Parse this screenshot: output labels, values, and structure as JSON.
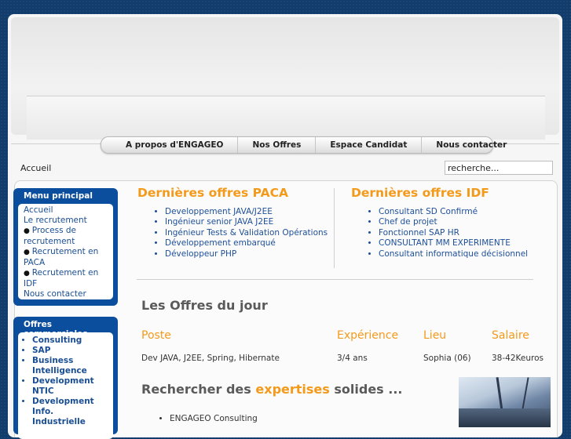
{
  "nav": {
    "items": [
      {
        "label": "A propos d'ENGAGEO"
      },
      {
        "label": "Nos Offres"
      },
      {
        "label": "Espace Candidat"
      },
      {
        "label": "Nous contacter"
      }
    ]
  },
  "breadcrumb": "Accueil",
  "search": {
    "value": "recherche..."
  },
  "sidebar": {
    "main_menu": {
      "title": "Menu principal",
      "items": [
        "Accueil",
        "Le recrutement",
        "Process de recrutement",
        "Recrutement en PACA",
        "Recrutement en IDF",
        "Nous contacter"
      ]
    },
    "commercial": {
      "title": "Offres commerciales",
      "items": [
        "Consulting",
        "SAP",
        "Business Intelligence",
        "Development NTIC",
        "Development Info. Industrielle"
      ]
    }
  },
  "paca": {
    "title": "Dernières offres PACA",
    "items": [
      "Developpement JAVA/J2EE",
      "Ingénieur senior JAVA J2EE",
      "Ingénieur Tests & Validation Opérations",
      "Développement embarqué",
      "Développeur PHP"
    ]
  },
  "idf": {
    "title": "Dernières offres IDF",
    "items": [
      "Consultant SD Confirmé",
      "Chef de projet",
      "Fonctionnel SAP HR",
      "CONSULTANT MM EXPERIMENTE",
      "Consultant informatique décisionnel"
    ]
  },
  "offres_du_jour": {
    "title": "Les Offres du jour",
    "headers": [
      "Poste",
      "Expérience",
      "Lieu",
      "Salaire"
    ],
    "row": [
      "Dev JAVA, J2EE, Spring, Hibernate",
      "3/4 ans",
      "Sophia (06)",
      "38-42Keuros"
    ]
  },
  "expertise": {
    "prefix": "Rechercher des",
    "highlight": "expertises",
    "suffix": "solides ...",
    "items": [
      "ENGAGEO Consulting"
    ]
  },
  "colors": {
    "accent": "#f39a1b",
    "sidebar": "#0b4e9e",
    "link": "#1d4f99",
    "background": "#123c6b"
  }
}
